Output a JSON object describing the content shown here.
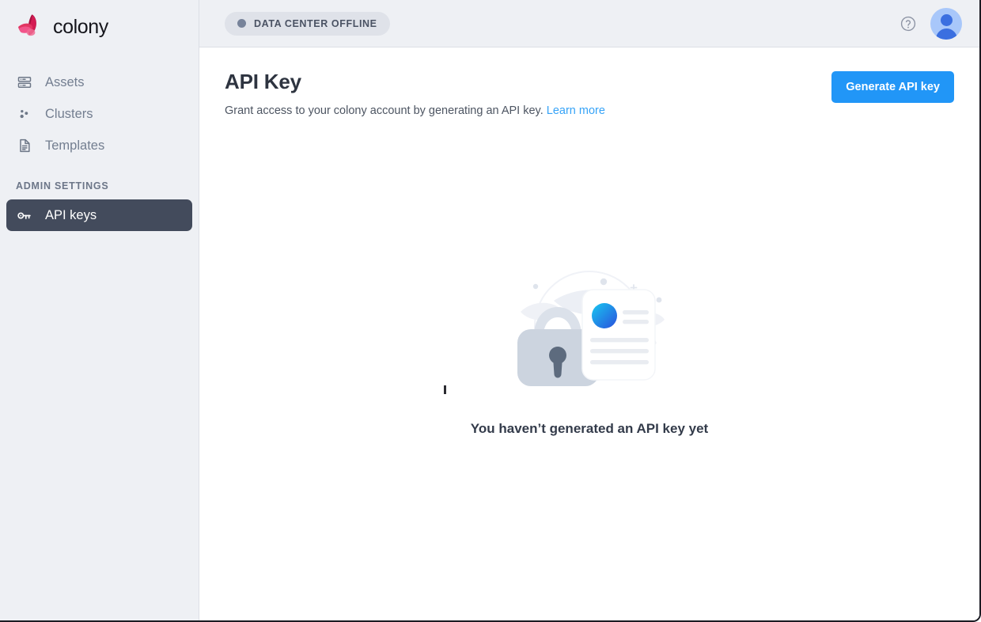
{
  "brand": {
    "name": "colony",
    "logo_icon": "butterfly-logo",
    "logo_colors": [
      "#f24f7e",
      "#a8123f",
      "#d41b53"
    ]
  },
  "sidebar": {
    "items": [
      {
        "label": "Assets",
        "icon": "server-rack-icon",
        "active": false
      },
      {
        "label": "Clusters",
        "icon": "cluster-dots-icon",
        "active": false
      },
      {
        "label": "Templates",
        "icon": "document-icon",
        "active": false
      }
    ],
    "section_title": "ADMIN SETTINGS",
    "admin_items": [
      {
        "label": "API keys",
        "icon": "key-icon",
        "active": true
      }
    ],
    "background_color": "#eef0f4",
    "active_color": "#434b5c"
  },
  "topbar": {
    "status_badge": {
      "label": "DATA CENTER OFFLINE",
      "dot_icon": "status-dot",
      "dot_color": "#77839a",
      "background_color": "#dfe2e9"
    },
    "help_icon": "question-circle-icon",
    "avatar_icon": "user-avatar-icon",
    "avatar_color": "#a8c7fa"
  },
  "page": {
    "title": "API Key",
    "subtitle_text": "Grant access to your colony account by generating an API key.",
    "subtitle_link": "Learn more",
    "primary_button": "Generate API key",
    "primary_button_color": "#2196f7",
    "link_color": "#36a3f7"
  },
  "empty_state": {
    "illustration_icon": "lock-and-document-illustration",
    "message": "You haven’t generated an API key yet"
  },
  "annotation": {
    "arrow_icon": "red-arrow-up-right",
    "arrow_color": "#e8141b"
  }
}
